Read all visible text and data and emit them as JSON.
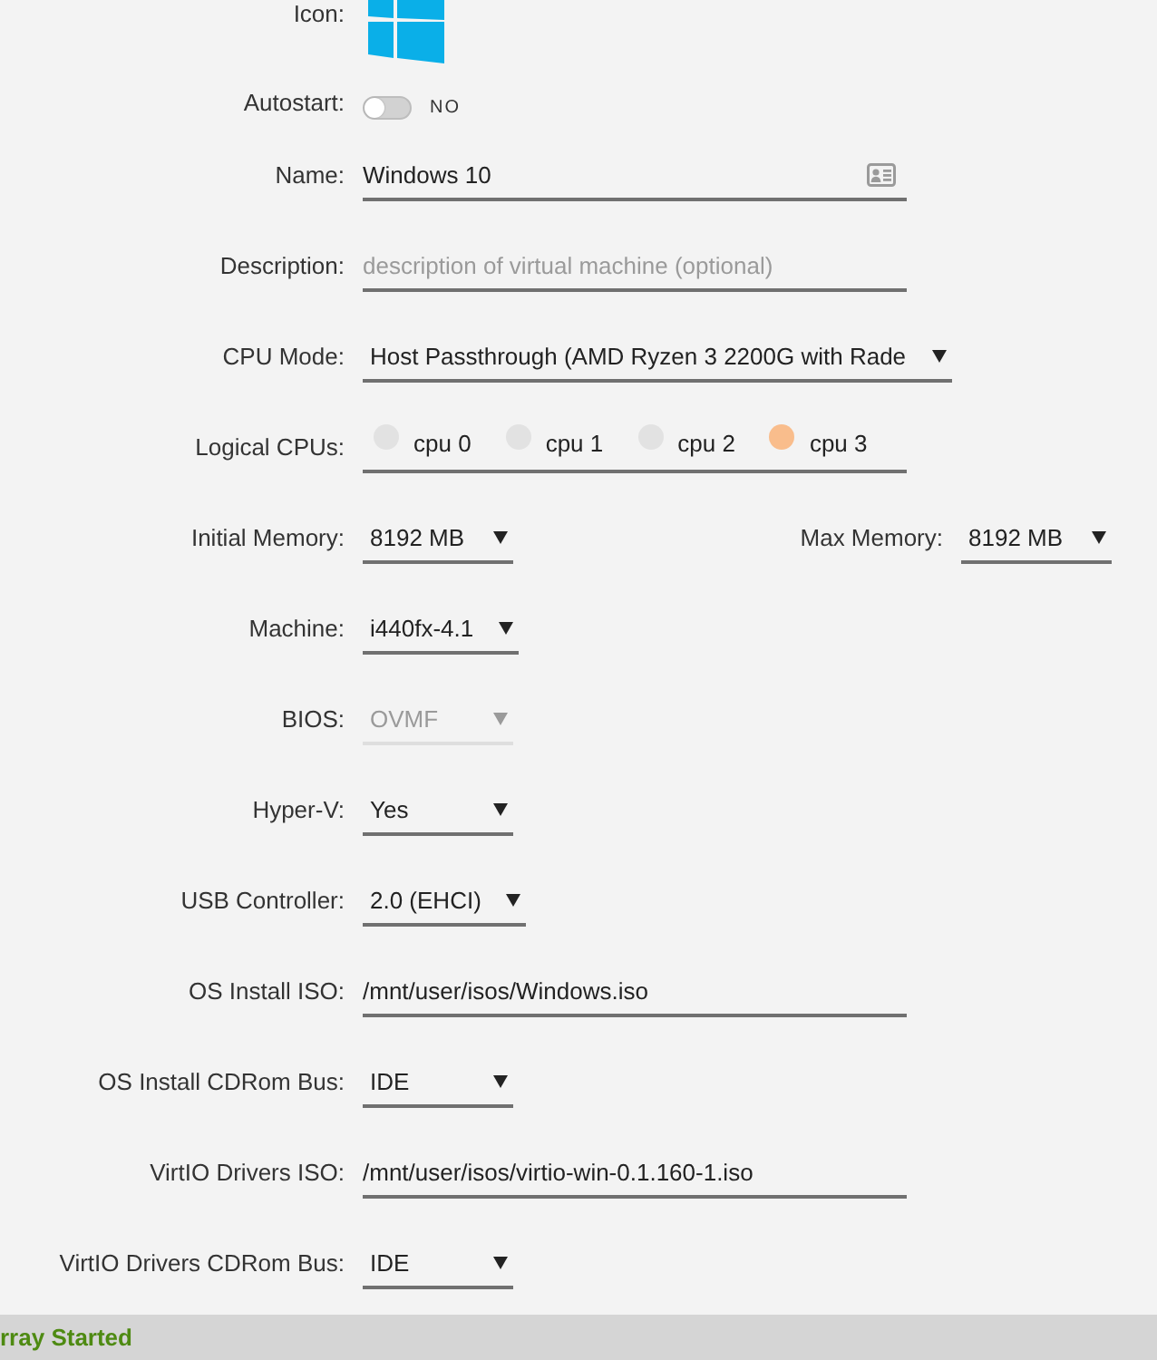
{
  "form": {
    "rows": [
      {
        "kind": "icon",
        "label": "Icon:"
      },
      {
        "kind": "toggle",
        "label": "Autostart:",
        "on": false,
        "text": "NO",
        "disabled": false
      },
      {
        "kind": "text",
        "label": "Name:",
        "value": "Windows 10",
        "picker": true,
        "disabled": false
      },
      {
        "kind": "text",
        "label": "Description:",
        "placeholder": "description of virtual machine (optional)",
        "picker": false,
        "disabled": false
      },
      {
        "kind": "select",
        "label": "CPU Mode:",
        "value": "Host Passthrough (AMD Ryzen 3 2200G with Rade",
        "disabled": false
      },
      {
        "kind": "checkboxes",
        "label": "Logical CPUs:",
        "disabled": false,
        "options": [
          {
            "label": "cpu 0",
            "checked": false
          },
          {
            "label": "cpu 1",
            "checked": false
          },
          {
            "label": "cpu 2",
            "checked": false
          },
          {
            "label": "cpu 3",
            "checked": true
          }
        ]
      },
      {
        "kind": "select",
        "label": "Initial Memory:",
        "value": "8192 MB",
        "disabled": false,
        "side": {
          "label": "Max Memory:",
          "value": "8192 MB",
          "disabled": false
        }
      },
      {
        "kind": "select",
        "label": "Machine:",
        "value": "i440fx-4.1",
        "disabled": false
      },
      {
        "kind": "select",
        "label": "BIOS:",
        "value": "OVMF",
        "disabled": true
      },
      {
        "kind": "select",
        "label": "Hyper-V:",
        "value": "Yes",
        "disabled": false
      },
      {
        "kind": "select",
        "label": "USB Controller:",
        "value": "2.0 (EHCI)",
        "disabled": false
      },
      {
        "kind": "text",
        "label": "OS Install ISO:",
        "value": "/mnt/user/isos/Windows.iso",
        "picker": false,
        "disabled": false
      },
      {
        "kind": "select",
        "label": "OS Install CDRom Bus:",
        "value": "IDE",
        "disabled": false
      },
      {
        "kind": "text",
        "label": "VirtIO Drivers ISO:",
        "value": "/mnt/user/isos/virtio-win-0.1.160-1.iso",
        "picker": false,
        "disabled": false
      },
      {
        "kind": "select",
        "label": "VirtIO Drivers CDRom Bus:",
        "value": "IDE",
        "disabled": false
      }
    ]
  },
  "status_bar": {
    "text": "rray Started"
  }
}
